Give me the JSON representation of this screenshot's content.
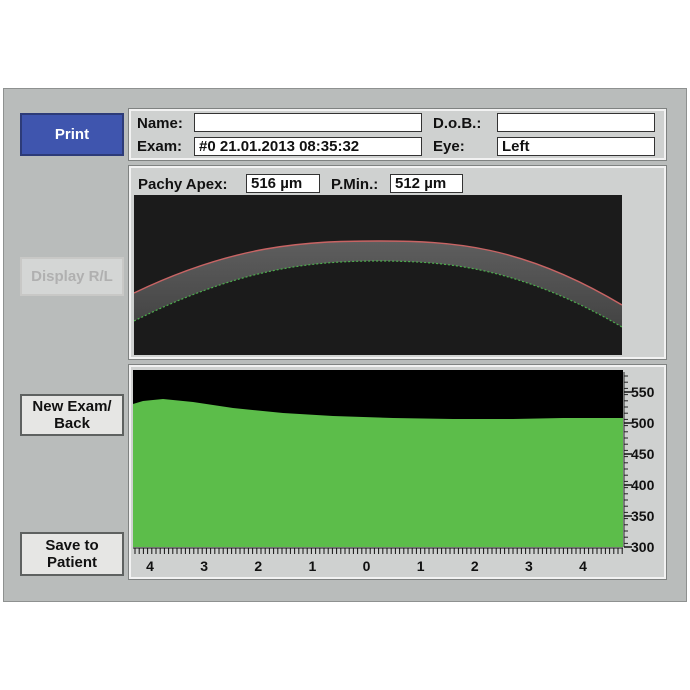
{
  "buttons": {
    "print": "Print",
    "display": "Display R/L",
    "new_exam": "New Exam/\nBack",
    "save": "Save to\nPatient"
  },
  "patient": {
    "name_label": "Name:",
    "name_value": "",
    "exam_label": "Exam:",
    "exam_value": "#0 21.01.2013 08:35:32",
    "dob_label": "D.o.B.:",
    "dob_value": "",
    "eye_label": "Eye:",
    "eye_value": "Left"
  },
  "pachy": {
    "apex_label": "Pachy Apex:",
    "apex_value": "516 µm",
    "pmin_label": "P.Min.:",
    "pmin_value": "512 µm"
  },
  "graph": {
    "y_ticks": [
      "550",
      "500",
      "450",
      "400",
      "350",
      "300"
    ],
    "x_ticks": [
      "4",
      "3",
      "2",
      "1",
      "0",
      "1",
      "2",
      "3",
      "4"
    ],
    "colors": {
      "fill": "#5cbd4a",
      "background": "#000000"
    }
  }
}
